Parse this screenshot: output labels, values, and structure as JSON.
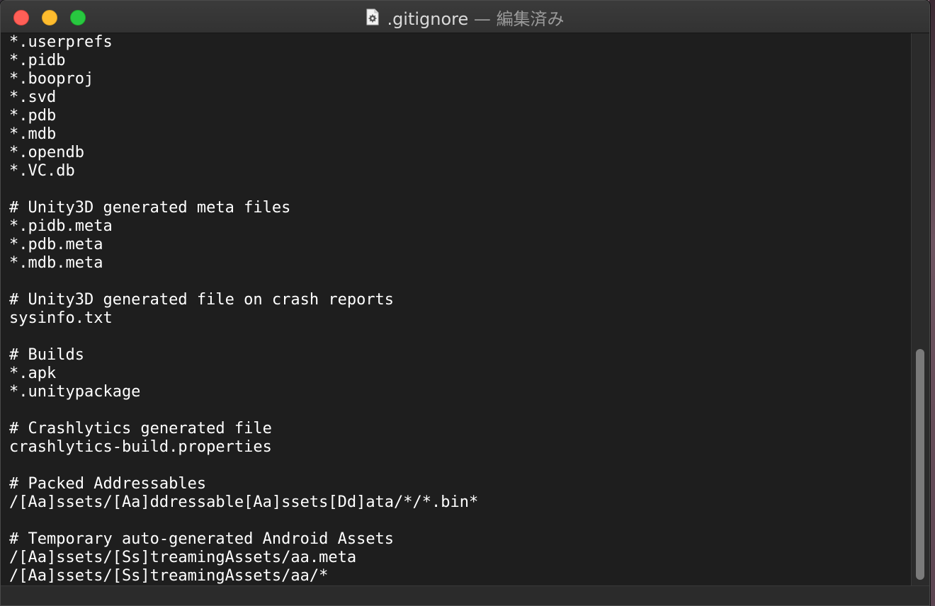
{
  "window": {
    "title": ".gitignore",
    "separator": "—",
    "status": "編集済み",
    "document_icon": "settings-document-icon"
  },
  "editor": {
    "lines": [
      "*.userprefs",
      "*.pidb",
      "*.booproj",
      "*.svd",
      "*.pdb",
      "*.mdb",
      "*.opendb",
      "*.VC.db",
      "",
      "# Unity3D generated meta files",
      "*.pidb.meta",
      "*.pdb.meta",
      "*.mdb.meta",
      "",
      "# Unity3D generated file on crash reports",
      "sysinfo.txt",
      "",
      "# Builds",
      "*.apk",
      "*.unitypackage",
      "",
      "# Crashlytics generated file",
      "crashlytics-build.properties",
      "",
      "# Packed Addressables",
      "/[Aa]ssets/[Aa]ddressable[Aa]ssets[Dd]ata/*/*.bin*",
      "",
      "# Temporary auto-generated Android Assets",
      "/[Aa]ssets/[Ss]treamingAssets/aa.meta",
      "/[Aa]ssets/[Ss]treamingAssets/aa/*"
    ]
  },
  "colors": {
    "background": "#1e1e1e",
    "text": "#ffffff",
    "close": "#ff5f57",
    "minimize": "#febc2e",
    "zoom": "#28c840"
  }
}
